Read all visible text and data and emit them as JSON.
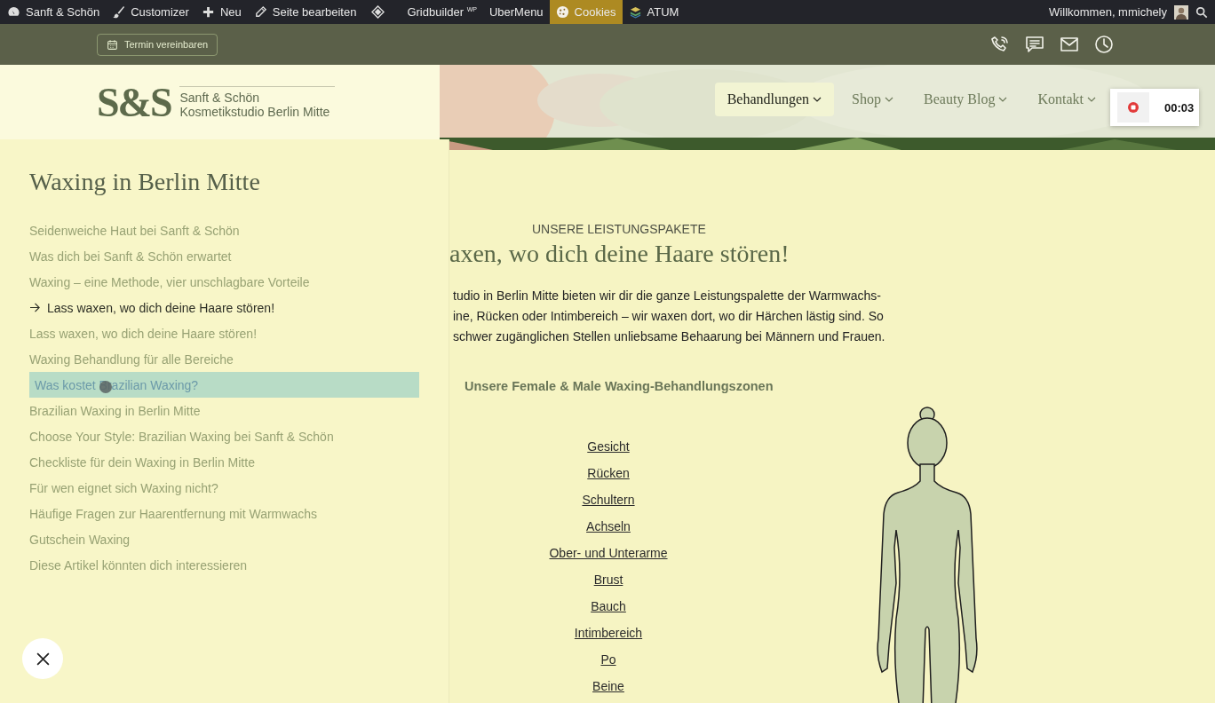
{
  "admin_bar": {
    "items": [
      {
        "label": "Sanft & Schön",
        "highlighted": false
      },
      {
        "label": "Customizer",
        "highlighted": false
      },
      {
        "label": "Neu",
        "highlighted": false
      },
      {
        "label": "Seite bearbeiten",
        "highlighted": false
      },
      {
        "kind": "icon",
        "highlighted": false
      },
      {
        "label": "Gridbuilder $^{WP}$",
        "highlighted": false
      },
      {
        "label": "UberMenu",
        "highlighted": false
      },
      {
        "label": "Cookies",
        "highlighted": true
      },
      {
        "label": "ATUM",
        "highlighted": false
      }
    ],
    "welcome": "Willkommen, mmichely"
  },
  "top_band": {
    "button": "Termin vereinbaren"
  },
  "header": {
    "logo_mark": "S&S",
    "logo_title": "Sanft & Schön",
    "logo_subtitle": "Kosmetikstudio Berlin Mitte",
    "nav": [
      {
        "label": "Behandlungen",
        "selected": true
      },
      {
        "label": "Shop",
        "selected": false
      },
      {
        "label": "Beauty Blog",
        "selected": false
      },
      {
        "label": "Kontakt",
        "selected": false
      }
    ],
    "recording": {
      "time": "00:03"
    }
  },
  "toc": {
    "title": "Waxing in Berlin Mitte",
    "items": [
      {
        "label": "Seidenweiche Haut bei Sanft & Schön",
        "current": false,
        "highlighted": false
      },
      {
        "label": "Was dich bei Sanft & Schön erwartet",
        "current": false,
        "highlighted": false
      },
      {
        "label": "Waxing – eine Methode, vier unschlagbare Vorteile",
        "current": false,
        "highlighted": false
      },
      {
        "label": "Lass waxen, wo dich deine Haare stören!",
        "current": true,
        "highlighted": false
      },
      {
        "label": "Lass waxen, wo dich deine Haare stören!",
        "current": false,
        "highlighted": false
      },
      {
        "label": "Waxing Behandlung für alle Bereiche",
        "current": false,
        "highlighted": false
      },
      {
        "label": "Was kostet Brazilian Waxing?",
        "current": false,
        "highlighted": true
      },
      {
        "label": "Brazilian Waxing in Berlin Mitte",
        "current": false,
        "highlighted": false
      },
      {
        "label": "Choose Your Style: Brazilian Waxing bei Sanft & Schön",
        "current": false,
        "highlighted": false
      },
      {
        "label": "Checkliste für dein Waxing in Berlin Mitte",
        "current": false,
        "highlighted": false
      },
      {
        "label": "Für wen eignet sich Waxing nicht?",
        "current": false,
        "highlighted": false
      },
      {
        "label": "Häufige Fragen zur Haarentfernung mit Warmwachs",
        "current": false,
        "highlighted": false
      },
      {
        "label": "Gutschein Waxing",
        "current": false,
        "highlighted": false
      },
      {
        "label": "Diese Artikel könnten dich interessieren",
        "current": false,
        "highlighted": false
      }
    ]
  },
  "main": {
    "eyebrow": "UNSERE LEISTUNGSPAKETE",
    "heading": "axen, wo dich deine Haare stören!",
    "body_lines": [
      "tudio in Berlin Mitte bieten wir dir die ganze Leistungspalette der Warmwachs-",
      "ine, Rücken oder Intimbereich – wir waxen dort, wo dir Härchen lästig sind. So",
      "schwer zugänglichen Stellen unliebsame Behaarung bei Männern und Frauen."
    ],
    "subheading": "Unsere Female & Male Waxing-Behandlungszonen",
    "zones": [
      "Gesicht",
      "Rücken",
      "Schultern",
      "Achseln",
      "Ober- und Unterarme",
      "Brust",
      "Bauch",
      "Intimbereich",
      "Po",
      "Beine"
    ]
  }
}
